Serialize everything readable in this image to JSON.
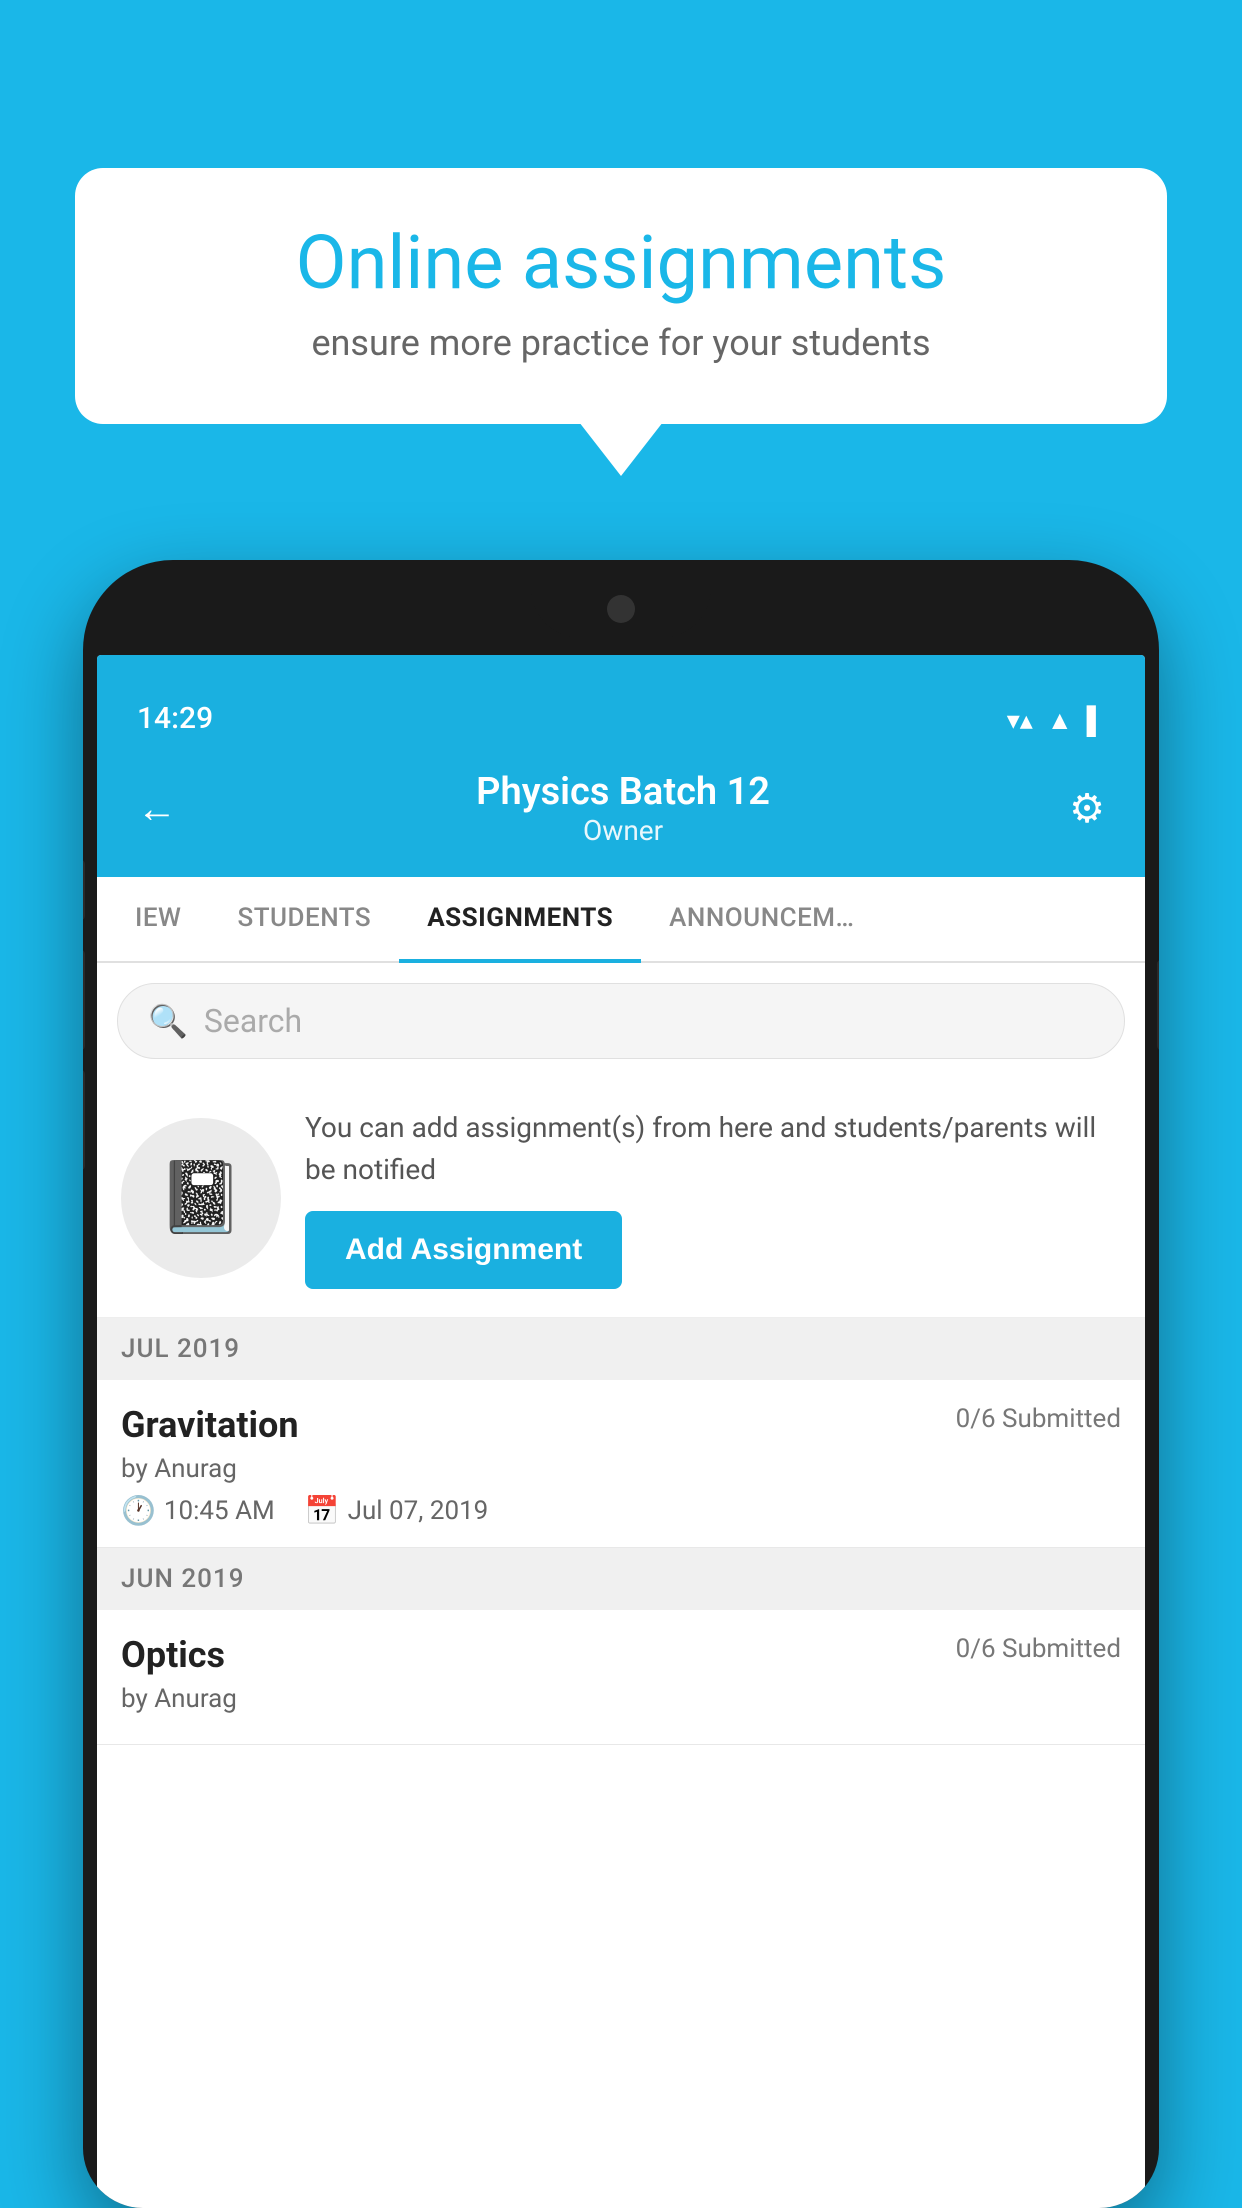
{
  "background_color": "#1ab7e8",
  "speech_bubble": {
    "title": "Online assignments",
    "subtitle": "ensure more practice for your students"
  },
  "status_bar": {
    "time": "14:29",
    "wifi_icon": "▼",
    "signal_icon": "▲",
    "battery_icon": "▌"
  },
  "header": {
    "title": "Physics Batch 12",
    "subtitle": "Owner",
    "back_label": "←",
    "settings_label": "⚙"
  },
  "tabs": [
    {
      "label": "IEW",
      "active": false
    },
    {
      "label": "STUDENTS",
      "active": false
    },
    {
      "label": "ASSIGNMENTS",
      "active": true
    },
    {
      "label": "ANNOUNCEM…",
      "active": false
    }
  ],
  "search": {
    "placeholder": "Search"
  },
  "promo": {
    "text": "You can add assignment(s) from here and students/parents will be notified",
    "button_label": "Add Assignment"
  },
  "sections": [
    {
      "label": "JUL 2019",
      "assignments": [
        {
          "name": "Gravitation",
          "submitted": "0/6 Submitted",
          "by": "by Anurag",
          "time": "10:45 AM",
          "date": "Jul 07, 2019"
        }
      ]
    },
    {
      "label": "JUN 2019",
      "assignments": [
        {
          "name": "Optics",
          "submitted": "0/6 Submitted",
          "by": "by Anurag",
          "time": "",
          "date": ""
        }
      ]
    }
  ]
}
